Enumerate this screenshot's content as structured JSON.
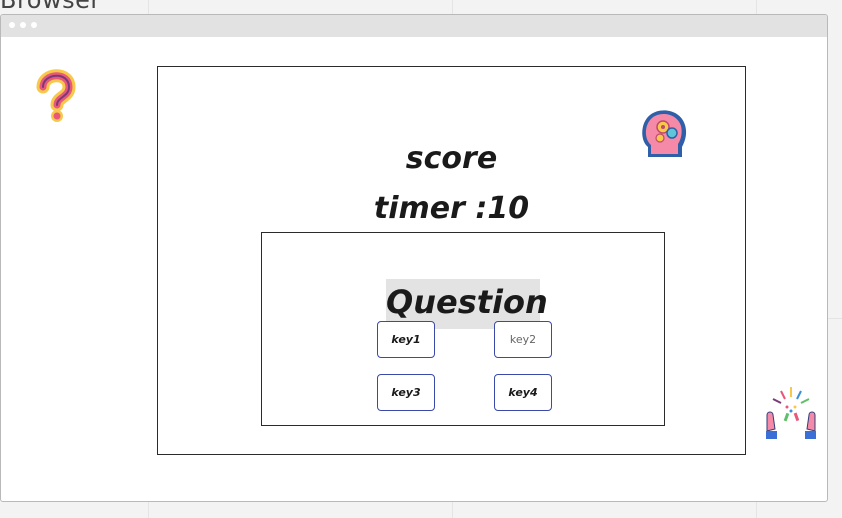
{
  "window": {
    "title": "Browser"
  },
  "game": {
    "score_label": "score",
    "timer_label": "timer :10",
    "question_label": "Question",
    "keys": [
      {
        "label": "key1"
      },
      {
        "label": "key2"
      },
      {
        "label": "key3"
      },
      {
        "label": "key4"
      }
    ]
  },
  "icons": {
    "question": "question-mark-icon",
    "brain": "brain-head-icon",
    "celebration": "celebration-hands-icon"
  },
  "colors": {
    "button_border": "#3b4aa8",
    "question_highlight": "#e3e3e3",
    "browser_bar": "#e2e2e2"
  }
}
